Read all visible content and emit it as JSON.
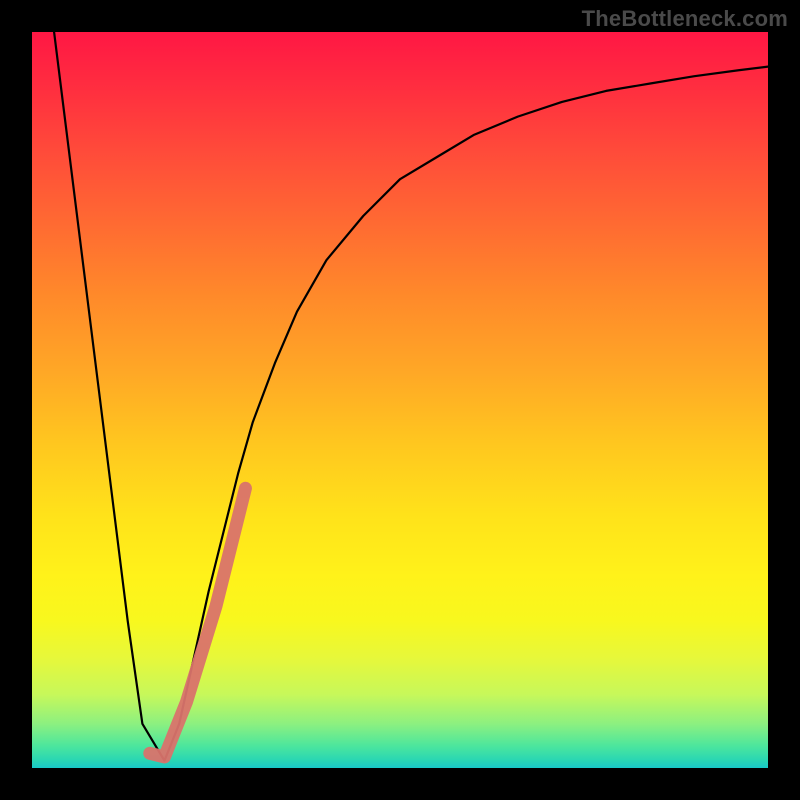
{
  "watermark": "TheBottleneck.com",
  "chart_data": {
    "type": "line",
    "title": "",
    "xlabel": "",
    "ylabel": "",
    "xlim": [
      0,
      100
    ],
    "ylim": [
      0,
      100
    ],
    "grid": false,
    "series": [
      {
        "name": "bottleneck-curve",
        "color": "#000000",
        "x": [
          3,
          5,
          7,
          9,
          11,
          13,
          15,
          18,
          20,
          22,
          24,
          26,
          28,
          30,
          33,
          36,
          40,
          45,
          50,
          55,
          60,
          66,
          72,
          78,
          84,
          90,
          96,
          100
        ],
        "y": [
          100,
          84,
          68,
          52,
          36,
          20,
          6,
          1,
          6,
          15,
          24,
          32,
          40,
          47,
          55,
          62,
          69,
          75,
          80,
          83,
          86,
          88.5,
          90.5,
          92,
          93,
          94,
          94.8,
          95.3
        ]
      }
    ],
    "minimum_point": {
      "x": 18,
      "y": 1
    },
    "highlight_segment": {
      "name": "highlight-overlay",
      "color": "#d9736b",
      "x": [
        16,
        18,
        21,
        25,
        29
      ],
      "y": [
        2,
        1.5,
        9,
        22,
        38
      ]
    },
    "background_gradient": {
      "top": "#ff1744",
      "mid": "#ffe31a",
      "bottom": "#18c8c8"
    }
  }
}
